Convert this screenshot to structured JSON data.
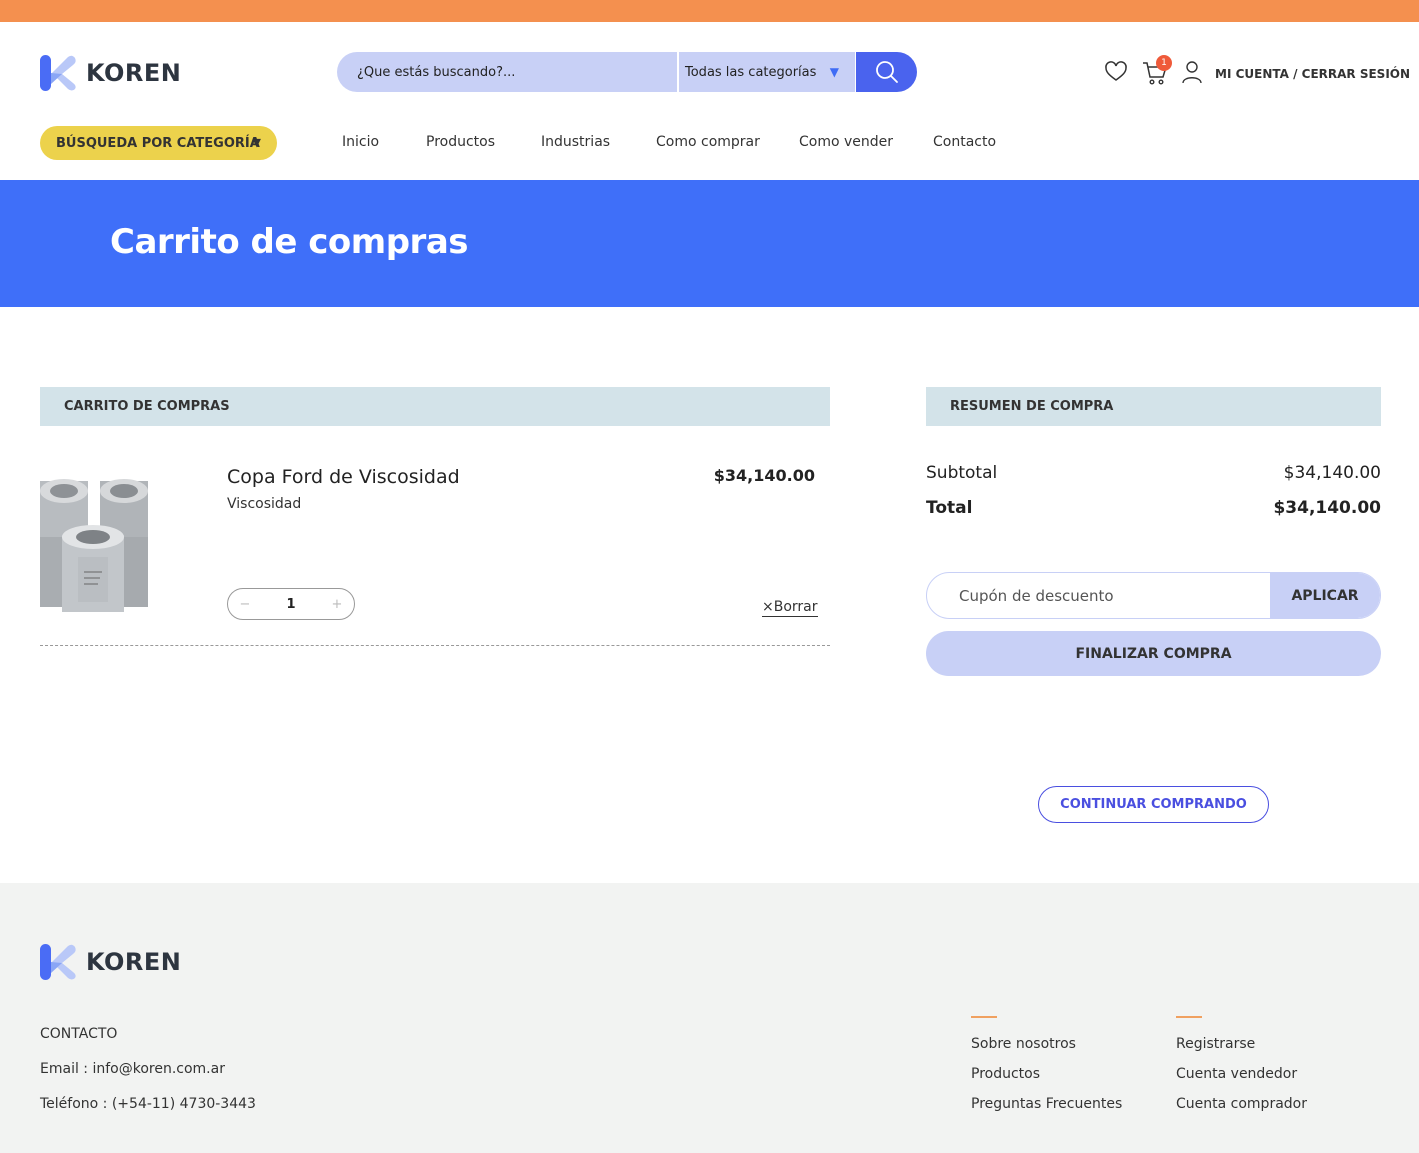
{
  "brand": {
    "name": "KOREN",
    "accent_orange": "#f4904f",
    "accent_blue": "#3f6ff9",
    "accent_yellow": "#ecd24c"
  },
  "search": {
    "placeholder": "¿Que estás buscando?...",
    "category": "Todas las categorías"
  },
  "header": {
    "account_label": "MI CUENTA / CERRAR SESIÓN",
    "cart_count": "1"
  },
  "nav": {
    "category_button": "BÚSQUEDA POR CATEGORÍA",
    "items": [
      "Inicio",
      "Productos",
      "Industrias",
      "Como comprar",
      "Como vender",
      "Contacto"
    ]
  },
  "banner": {
    "title": "Carrito de compras"
  },
  "cart": {
    "heading": "CARRITO DE COMPRAS",
    "item": {
      "name": "Copa Ford de Viscosidad",
      "category": "Viscosidad",
      "price": "$34,140.00",
      "quantity": "1",
      "remove_label": "Borrar"
    }
  },
  "summary": {
    "heading": "RESUMEN DE COMPRA",
    "subtotal_label": "Subtotal",
    "subtotal_value": "$34,140.00",
    "total_label": "Total",
    "total_value": "$34,140.00",
    "coupon_placeholder": "Cupón de descuento",
    "apply_label": "APLICAR",
    "finalize_label": "FINALIZAR COMPRA",
    "continue_label": "CONTINUAR COMPRANDO"
  },
  "footer": {
    "contact_heading": "CONTACTO",
    "email": "Email : info@koren.com.ar",
    "phone": "Teléfono : (+54-11) 4730-3443",
    "col1": [
      "Sobre nosotros",
      "Productos",
      "Preguntas Frecuentes"
    ],
    "col2": [
      "Registrarse",
      "Cuenta vendedor",
      "Cuenta comprador"
    ]
  }
}
